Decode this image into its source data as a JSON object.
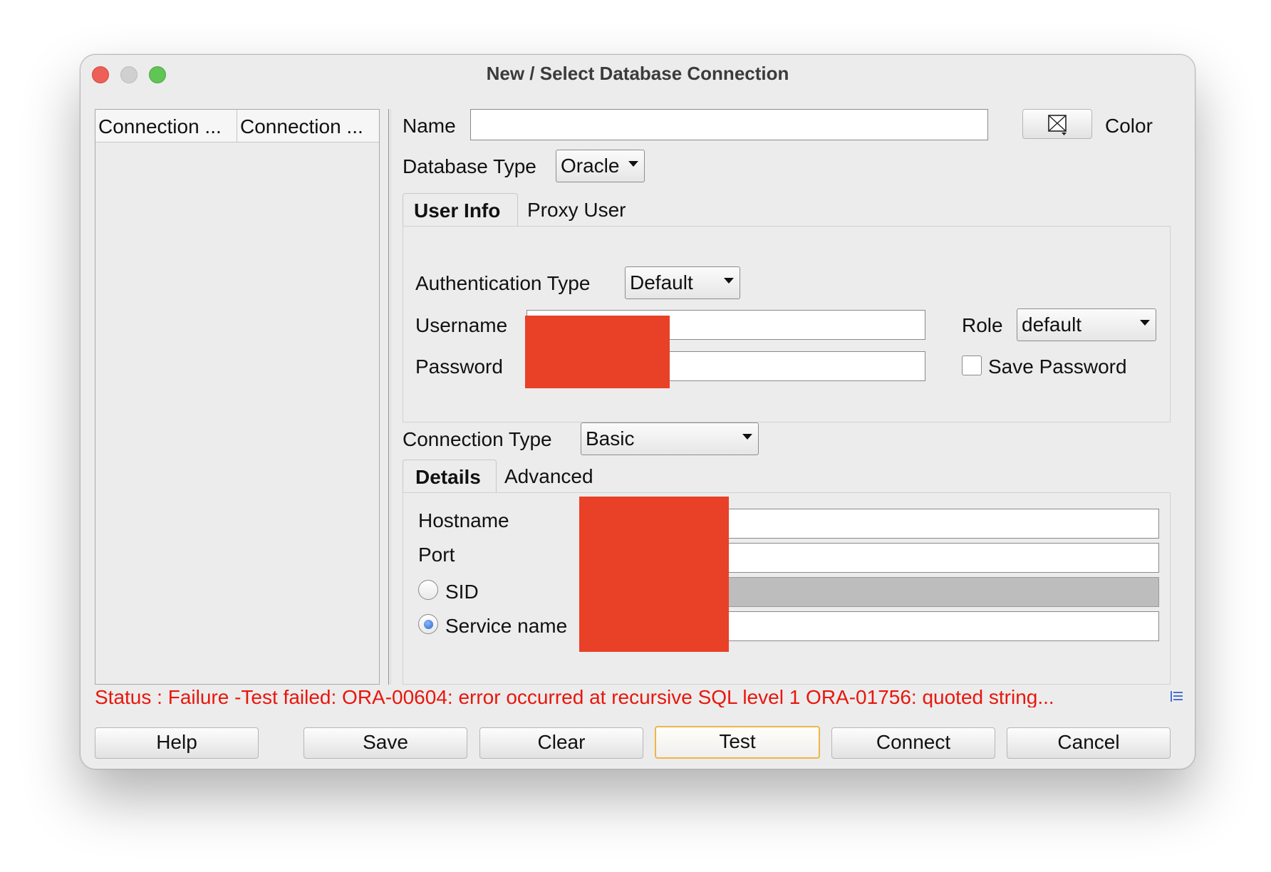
{
  "window": {
    "title": "New / Select Database Connection"
  },
  "connections_table": {
    "columns": [
      "Connection ...",
      "Connection ..."
    ]
  },
  "form": {
    "name_label": "Name",
    "name_value": "",
    "color_label": "Color",
    "database_type_label": "Database Type",
    "database_type_value": "Oracle"
  },
  "user_tabs": [
    {
      "label": "User Info",
      "selected": true
    },
    {
      "label": "Proxy User",
      "selected": false
    }
  ],
  "user_info": {
    "auth_type_label": "Authentication Type",
    "auth_type_value": "Default",
    "username_label": "Username",
    "password_label": "Password",
    "role_label": "Role",
    "role_value": "default",
    "save_password_label": "Save Password",
    "save_password_checked": false
  },
  "connection": {
    "type_label": "Connection Type",
    "type_value": "Basic"
  },
  "detail_tabs": [
    {
      "label": "Details",
      "selected": true
    },
    {
      "label": "Advanced",
      "selected": false
    }
  ],
  "details": {
    "hostname_label": "Hostname",
    "port_label": "Port",
    "sid_label": "SID",
    "service_name_label": "Service name",
    "selected_option": "Service name"
  },
  "status": {
    "text": "Status : Failure -Test failed: ORA-00604: error occurred at recursive SQL level 1 ORA-01756: quoted string...",
    "color": "#e8160c"
  },
  "buttons": {
    "help": "Help",
    "save": "Save",
    "clear": "Clear",
    "test": "Test",
    "connect": "Connect",
    "cancel": "Cancel"
  },
  "icons": {
    "color_picker": "color-swatch-icon",
    "status_details": "list-lines-icon"
  }
}
